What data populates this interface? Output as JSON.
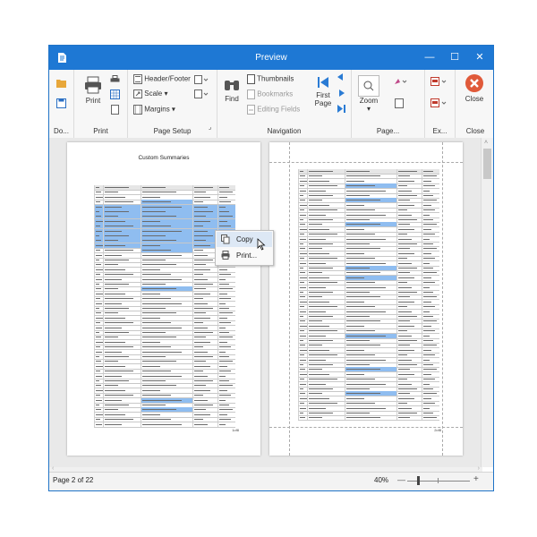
{
  "window": {
    "title": "Preview",
    "controls": [
      "—",
      "☐",
      "✕"
    ]
  },
  "ribbon": {
    "groups": [
      {
        "label": "Do...",
        "items": []
      },
      {
        "label": "Print",
        "items": [
          "Print"
        ]
      },
      {
        "label": "Page Setup",
        "items": [
          "Header/Footer",
          "Scale",
          "Margins"
        ]
      },
      {
        "label": "Navigation",
        "items": [
          "Find",
          "Thumbnails",
          "Bookmarks",
          "Editing Fields",
          "First Page"
        ]
      },
      {
        "label": "Page...",
        "items": [
          "Zoom"
        ]
      },
      {
        "label": "Ex...",
        "items": []
      },
      {
        "label": "Close",
        "items": [
          "Close"
        ]
      }
    ],
    "print_label": "Print",
    "header_footer": "Header/Footer",
    "scale": "Scale",
    "margins": "Margins",
    "find": "Find",
    "thumbnails": "Thumbnails",
    "bookmarks": "Bookmarks",
    "editing_fields": "Editing Fields",
    "first_page": "First Page",
    "zoom": "Zoom",
    "close": "Close",
    "group_labels": {
      "document": "Do...",
      "print": "Print",
      "page_setup": "Page Setup",
      "navigation": "Navigation",
      "page_bg": "Page...",
      "export": "Ex...",
      "close": "Close"
    }
  },
  "document": {
    "page1_title": "Custom Summaries",
    "page1_number": "1of8",
    "page2_number": "2of8"
  },
  "context_menu": {
    "items": [
      {
        "label": "Copy",
        "icon": "copy-icon"
      },
      {
        "label": "Print...",
        "icon": "printer-icon"
      }
    ]
  },
  "status": {
    "page_info": "Page 2 of 22",
    "zoom_level": "40%"
  },
  "colors": {
    "titlebar": "#1e78d4",
    "selection": "#7fb0ea",
    "close_button": "#e05a3a",
    "accent_blue": "#2a7bd4"
  }
}
